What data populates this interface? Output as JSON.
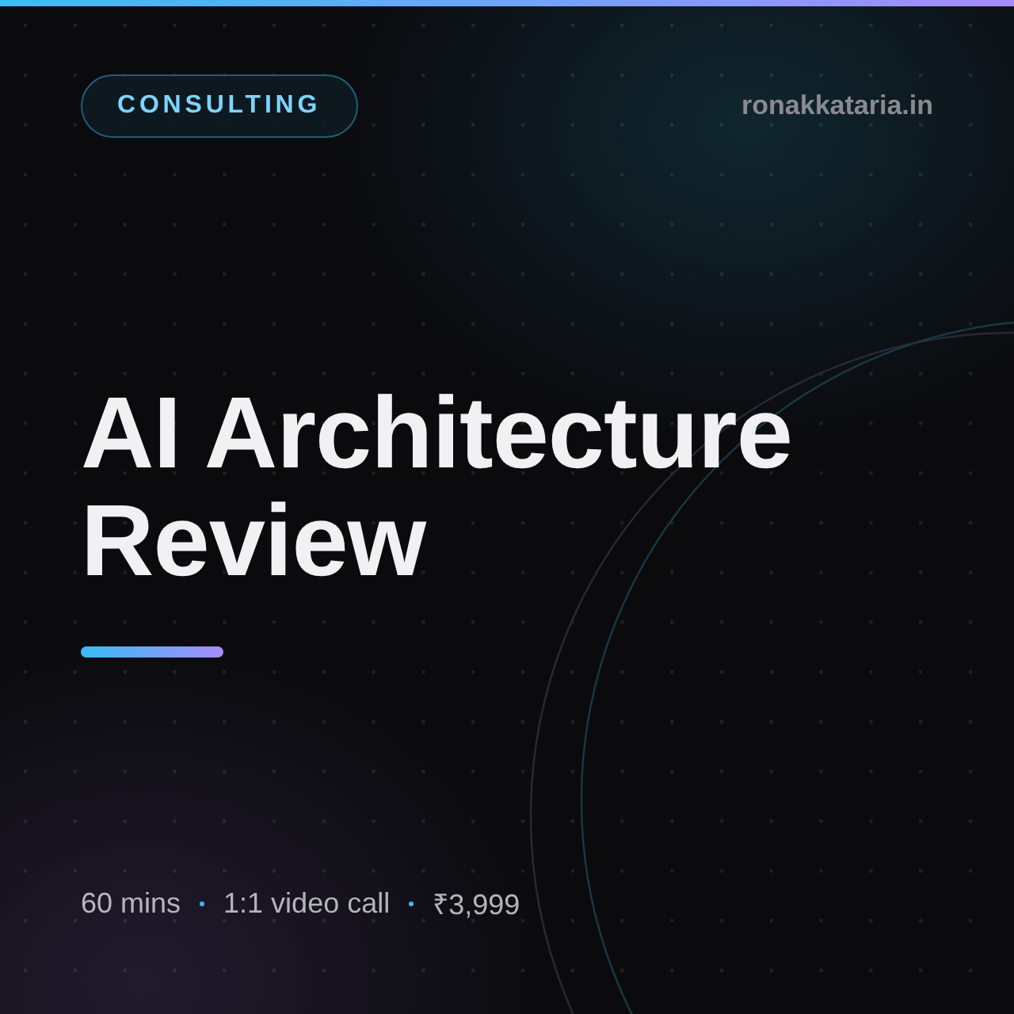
{
  "badge": "CONSULTING",
  "site": "ronakkataria.in",
  "title": "AI Architecture Review",
  "meta": [
    "60 mins",
    "1:1 video call",
    "₹3,999"
  ]
}
